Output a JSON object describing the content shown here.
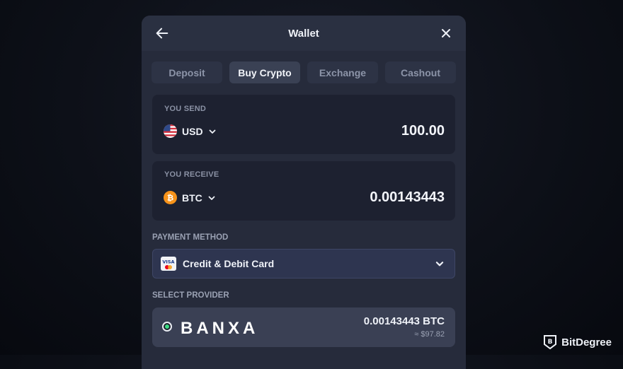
{
  "header": {
    "title": "Wallet"
  },
  "tabs": [
    {
      "label": "Deposit",
      "active": false
    },
    {
      "label": "Buy Crypto",
      "active": true
    },
    {
      "label": "Exchange",
      "active": false
    },
    {
      "label": "Cashout",
      "active": false
    }
  ],
  "send": {
    "label": "YOU SEND",
    "currency": "USD",
    "amount": "100.00",
    "icon": "us-flag-icon"
  },
  "receive": {
    "label": "YOU RECEIVE",
    "currency": "BTC",
    "amount": "0.00143443",
    "icon": "bitcoin-icon"
  },
  "payment": {
    "label": "PAYMENT METHOD",
    "selected": "Credit & Debit Card",
    "icon": "visa-mastercard-icon",
    "icon_text": "VISA"
  },
  "provider": {
    "label": "SELECT PROVIDER",
    "name": "BANXA",
    "amount": "0.00143443 BTC",
    "approx": "≈ $97.82"
  },
  "watermark": {
    "text": "BitDegree"
  },
  "colors": {
    "bitcoin": "#f7931a",
    "radio_active": "#3ddc84"
  }
}
